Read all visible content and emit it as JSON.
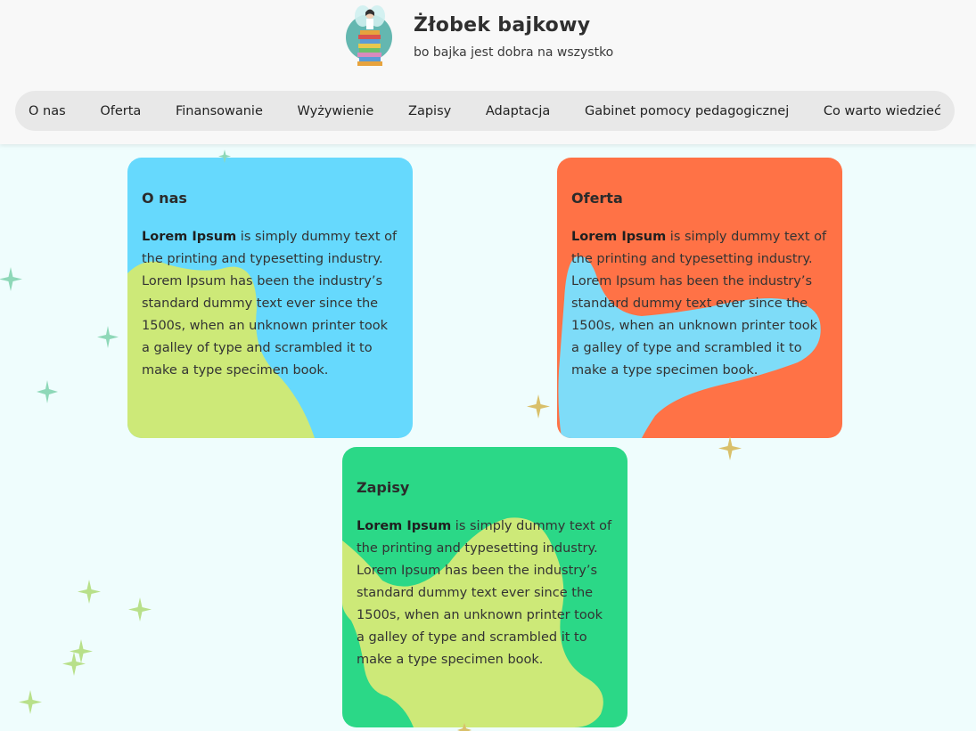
{
  "site": {
    "title": "Żłobek bajkowy",
    "tagline": "bo bajka jest dobra na wszystko"
  },
  "nav": {
    "items": [
      {
        "label": "O nas"
      },
      {
        "label": "Oferta"
      },
      {
        "label": "Finansowanie"
      },
      {
        "label": "Wyżywienie"
      },
      {
        "label": "Zapisy"
      },
      {
        "label": "Adaptacja"
      },
      {
        "label": "Gabinet pomocy pedagogicznej"
      },
      {
        "label": "Co warto wiedzieć"
      }
    ]
  },
  "cards": [
    {
      "title": "O nas",
      "bold": "Lorem Ipsum",
      "text": " is simply dummy text of the printing and typesetting industry. Lorem Ipsum has been the industry’s standard dummy text ever since the 1500s, when an unknown printer took a galley of type and scrambled it to make a type specimen book.",
      "bg_color": "#66d9fd",
      "blob_color": "#cde978"
    },
    {
      "title": "Oferta",
      "bold": "Lorem Ipsum",
      "text": " is simply dummy text of the printing and typesetting industry. Lorem Ipsum has been the industry’s standard dummy text ever since the 1500s, when an unknown printer took a galley of type and scrambled it to make a type specimen book.",
      "bg_color": "#ff7246",
      "blob_color": "#7edcf8"
    },
    {
      "title": "Zapisy",
      "bold": "Lorem Ipsum",
      "text": " is simply dummy text of the printing and typesetting industry. Lorem Ipsum has been the industry’s standard dummy text ever since the 1500s, when an unknown printer took a galley of type and scrambled it to make a type specimen book.",
      "bg_color": "#2bd887",
      "blob_color": "#cde978"
    }
  ],
  "colors": {
    "page_bg": "#effdfd",
    "header_bg": "#f8f8f8",
    "nav_bg": "#e8e8e8",
    "sparkle_green": "#8ed8b8",
    "sparkle_yellow": "#d9c06a",
    "sparkle_lime": "#b8e08a"
  }
}
